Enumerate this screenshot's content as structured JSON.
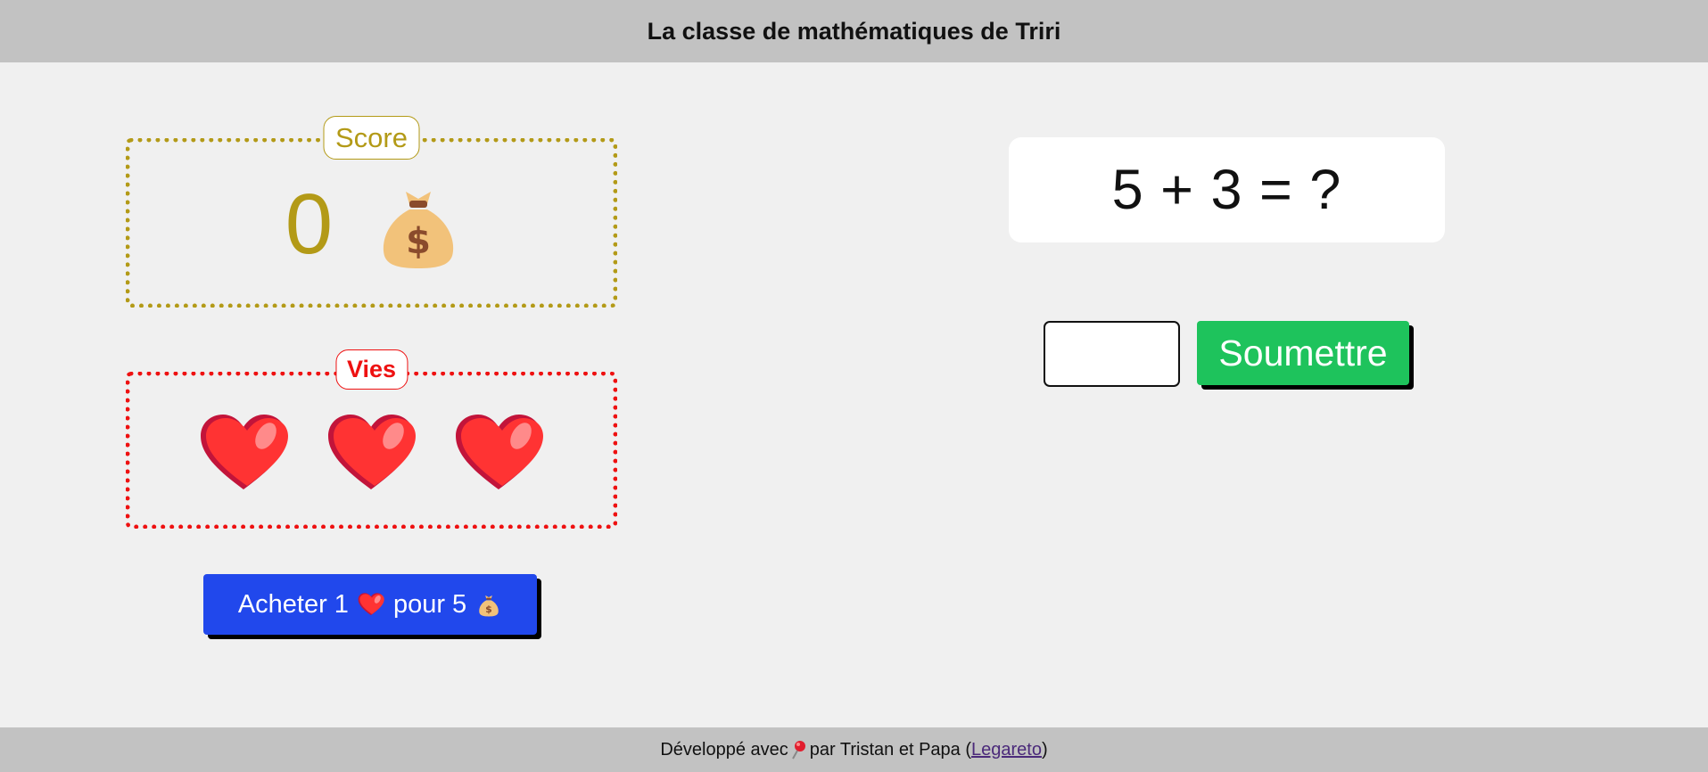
{
  "header": {
    "title": "La classe de mathématiques de Triri"
  },
  "score": {
    "legend": "Score",
    "value": "0",
    "icon": "money-bag-icon"
  },
  "lives": {
    "legend": "Vies",
    "count": 3,
    "icon": "heart-icon"
  },
  "buy": {
    "part1": "Acheter 1",
    "part2": "pour 5"
  },
  "question": {
    "text": "5 + 3 = ?"
  },
  "answer": {
    "value": "",
    "placeholder": ""
  },
  "submit": {
    "label": "Soumettre"
  },
  "footer": {
    "prefix": "Développé avec",
    "middle": "par Tristan et Papa (",
    "link": "Legareto",
    "suffix": ")"
  },
  "colors": {
    "score": "#b39a17",
    "lives": "#ee1111",
    "buy_button": "#2148ec",
    "submit_button": "#1ec35c",
    "bars": "#c2c2c2"
  }
}
